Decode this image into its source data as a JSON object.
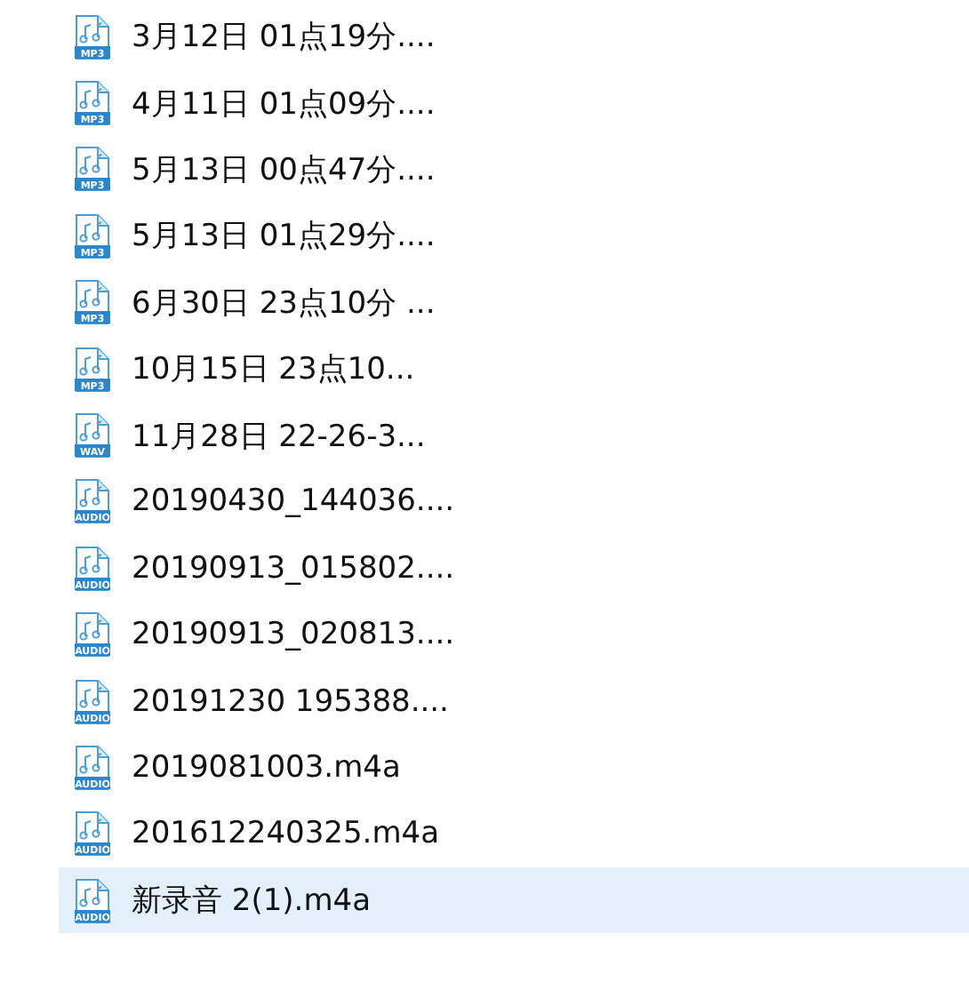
{
  "files": [
    {
      "name": "3月12日 01点19分....",
      "badge": "MP3",
      "selected": false
    },
    {
      "name": "4月11日 01点09分....",
      "badge": "MP3",
      "selected": false
    },
    {
      "name": "5月13日 00点47分....",
      "badge": "MP3",
      "selected": false
    },
    {
      "name": "5月13日 01点29分....",
      "badge": "MP3",
      "selected": false
    },
    {
      "name": "6月30日 23点10分 ...",
      "badge": "MP3",
      "selected": false
    },
    {
      "name": "10月15日 23点10...",
      "badge": "MP3",
      "selected": false
    },
    {
      "name": "11月28日 22-26-3...",
      "badge": "WAV",
      "selected": false
    },
    {
      "name": "20190430_144036....",
      "badge": "AUDIO",
      "selected": false
    },
    {
      "name": "20190913_015802....",
      "badge": "AUDIO",
      "selected": false
    },
    {
      "name": "20190913_020813....",
      "badge": "AUDIO",
      "selected": false
    },
    {
      "name": "20191230 195388....",
      "badge": "AUDIO",
      "selected": false
    },
    {
      "name": "2019081003.m4a",
      "badge": "AUDIO",
      "selected": false
    },
    {
      "name": "201612240325.m4a",
      "badge": "AUDIO",
      "selected": false
    },
    {
      "name": "新录音 2(1).m4a",
      "badge": "AUDIO",
      "selected": true
    }
  ]
}
